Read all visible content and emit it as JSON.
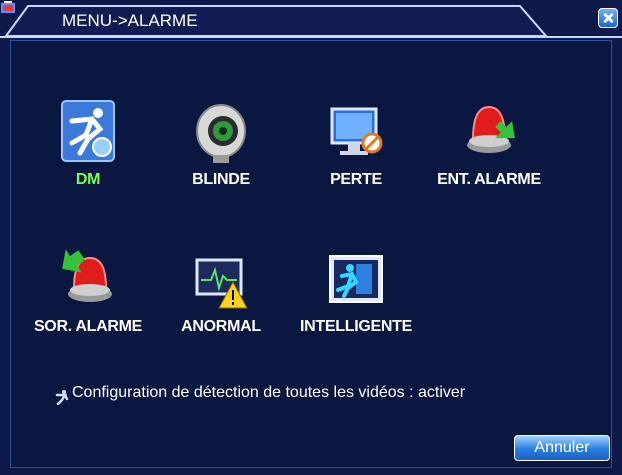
{
  "window": {
    "title": "MENU->ALARME"
  },
  "items": [
    {
      "label": "DM",
      "icon": "motion-detect-icon",
      "selected": true
    },
    {
      "label": "BLINDE",
      "icon": "camera-blind-icon"
    },
    {
      "label": "PERTE",
      "icon": "video-loss-icon"
    },
    {
      "label": "ENT. ALARME",
      "icon": "alarm-input-icon"
    },
    {
      "label": "SOR. ALARME",
      "icon": "alarm-output-icon"
    },
    {
      "label": "ANORMAL",
      "icon": "abnormal-icon"
    },
    {
      "label": "INTELLIGENTE",
      "icon": "intelligent-icon"
    }
  ],
  "status": {
    "text": "Configuration de détection de toutes les vidéos : activer"
  },
  "buttons": {
    "cancel": "Annuler"
  },
  "colors": {
    "background": "#0d1a4a",
    "selected_label": "#7cff4c",
    "accent": "#2a7fe0"
  }
}
